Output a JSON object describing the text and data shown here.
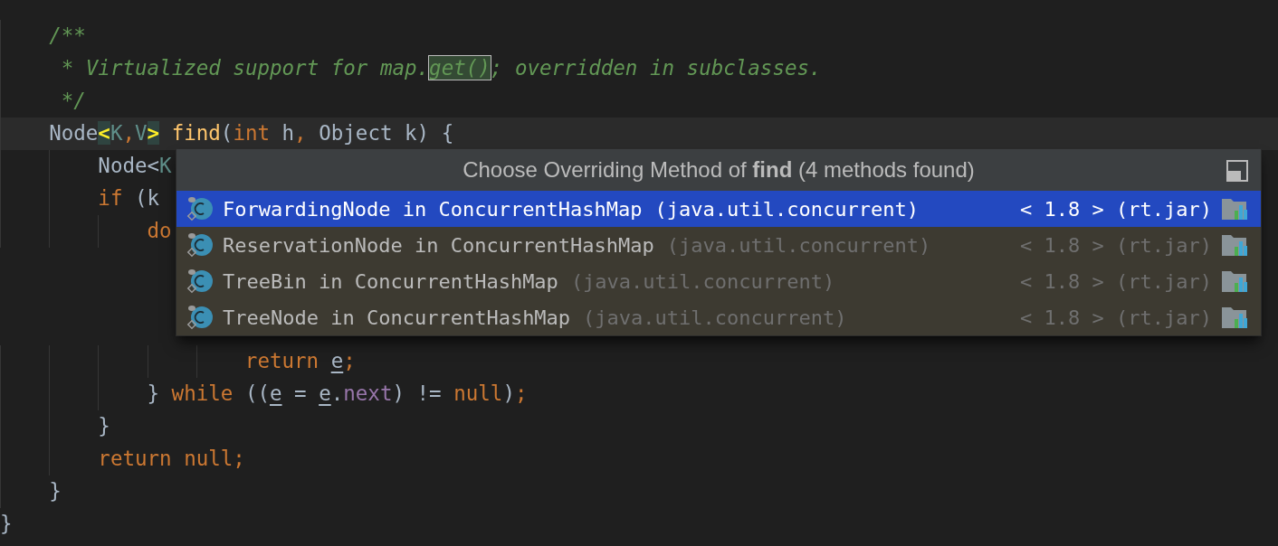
{
  "editor": {
    "lines": [
      {
        "children": [
          {
            "current": false,
            "tokens": [
              {
                "text": "/**",
                "kind": "comment"
              }
            ]
          },
          {
            "current": false,
            "tokens": [
              {
                "text": " * Virtualized support for map.",
                "kind": "comment"
              },
              {
                "text": "get()",
                "kind": "comment-highlight"
              },
              {
                "text": "; overridden in subclasses.",
                "kind": "comment"
              }
            ]
          },
          {
            "current": false,
            "tokens": [
              {
                "text": " */",
                "kind": "comment"
              }
            ]
          },
          {
            "current": true,
            "tokens": [
              {
                "text": "Node",
                "kind": "plain"
              },
              {
                "text": "<",
                "kind": "brace-match"
              },
              {
                "text": "K",
                "kind": "type-param"
              },
              {
                "text": ",",
                "kind": "keyword"
              },
              {
                "text": "V",
                "kind": "type-param"
              },
              {
                "text": ">",
                "kind": "brace-match"
              },
              {
                "text": " find",
                "kind": "method"
              },
              {
                "text": "(",
                "kind": "plain"
              },
              {
                "text": "int",
                "kind": "keyword"
              },
              {
                "text": " h",
                "kind": "plain"
              },
              {
                "text": ",",
                "kind": "keyword"
              },
              {
                "text": " Object k) {",
                "kind": "plain"
              }
            ],
            "children": [
              {
                "current": false,
                "tokens": [
                  {
                    "text": "Node<",
                    "kind": "plain"
                  },
                  {
                    "text": "K",
                    "kind": "type-param"
                  }
                ]
              },
              {
                "current": false,
                "tokens": [
                  {
                    "text": "if",
                    "kind": "keyword"
                  },
                  {
                    "text": " (k",
                    "kind": "plain"
                  }
                ],
                "children": [
                  {
                    "current": false,
                    "tokens": [
                      {
                        "text": "do",
                        "kind": "keyword"
                      }
                    ],
                    "children": [
                      {
                        "children": [
                          {
                            "current": false,
                            "tokens": [
                              {
                                "text": "return ",
                                "kind": "keyword"
                              },
                              {
                                "text": "e",
                                "kind": "reassigned"
                              },
                              {
                                "text": ";",
                                "kind": "keyword"
                              }
                            ]
                          }
                        ]
                      }
                    ]
                  },
                  {
                    "current": false,
                    "tokens": [
                      {
                        "text": "} ",
                        "kind": "plain"
                      },
                      {
                        "text": "while",
                        "kind": "keyword"
                      },
                      {
                        "text": " ((",
                        "kind": "plain"
                      },
                      {
                        "text": "e",
                        "kind": "reassigned"
                      },
                      {
                        "text": " = ",
                        "kind": "plain"
                      },
                      {
                        "text": "e",
                        "kind": "reassigned"
                      },
                      {
                        "text": ".",
                        "kind": "plain"
                      },
                      {
                        "text": "next",
                        "kind": "field"
                      },
                      {
                        "text": ") != ",
                        "kind": "plain"
                      },
                      {
                        "text": "null",
                        "kind": "keyword"
                      },
                      {
                        "text": ")",
                        "kind": "plain"
                      },
                      {
                        "text": ";",
                        "kind": "keyword"
                      }
                    ]
                  }
                ]
              },
              {
                "current": false,
                "tokens": [
                  {
                    "text": "}",
                    "kind": "plain"
                  }
                ]
              },
              {
                "current": false,
                "tokens": [
                  {
                    "text": "return null",
                    "kind": "keyword"
                  },
                  {
                    "text": ";",
                    "kind": "keyword"
                  }
                ]
              }
            ]
          },
          {
            "current": false,
            "tokens": [
              {
                "text": "}",
                "kind": "plain"
              }
            ]
          }
        ]
      },
      {
        "current": false,
        "tokens": [
          {
            "text": "}",
            "kind": "plain"
          }
        ]
      }
    ]
  },
  "popup": {
    "title": "Choose Overriding Method of **find** (4 methods found)",
    "items": [
      {
        "name": "ForwardingNode in ConcurrentHashMap",
        "package": "(java.util.concurrent)",
        "library": "< 1.8 > (rt.jar)",
        "selected": true
      },
      {
        "name": "ReservationNode in ConcurrentHashMap",
        "package": "(java.util.concurrent)",
        "library": "< 1.8 > (rt.jar)",
        "selected": false
      },
      {
        "name": "TreeBin in ConcurrentHashMap",
        "package": "(java.util.concurrent)",
        "library": "< 1.8 > (rt.jar)",
        "selected": false
      },
      {
        "name": "TreeNode in ConcurrentHashMap",
        "package": "(java.util.concurrent)",
        "library": "< 1.8 > (rt.jar)",
        "selected": false
      }
    ]
  }
}
